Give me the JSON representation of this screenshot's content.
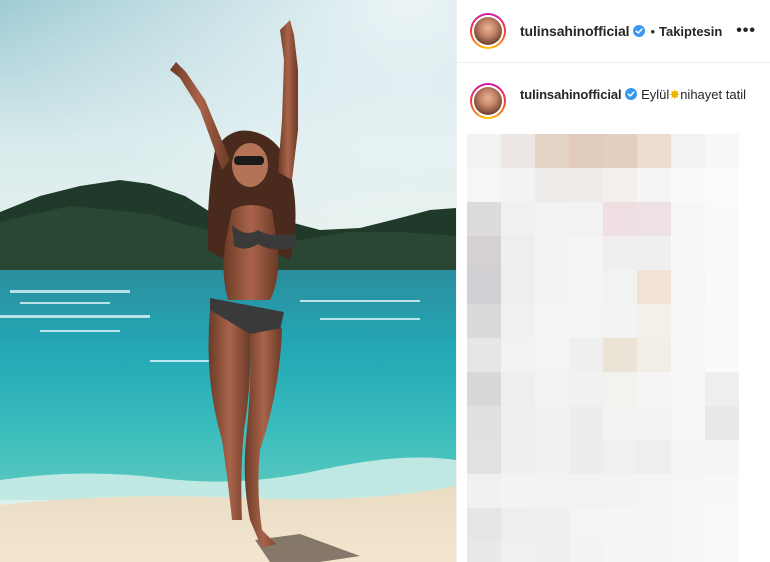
{
  "post": {
    "username": "tulinsahinofficial",
    "follow_status": "Takiptesin",
    "separator": "•",
    "more_label": "•••",
    "caption": {
      "username": "tulinsahinofficial",
      "text_before": "Eylül",
      "emoji": "✸",
      "text_after": "nihayet tatil"
    }
  },
  "colors": {
    "verified_blue": "#3897f0",
    "sea": "#22a7b4",
    "sky": "#cfe6ea"
  },
  "pixel_colors": [
    [
      "#f3f3f3",
      "#ece7e4",
      "#e4d4c6",
      "#e0cbbc",
      "#e3cfc0",
      "#ecdccf",
      "#f4f2f1",
      "#f7f7f7"
    ],
    [
      "#f6f6f6",
      "#f4f3f3",
      "#efebe9",
      "#eeebe9",
      "#f2efec",
      "#f6f5f4",
      "#fafafa",
      "#fbfbfb"
    ],
    [
      "#dedbdb",
      "#f1f0f0",
      "#f4f3f3",
      "#f3f2f2",
      "#efdfe3",
      "#eee1e6",
      "#f7f7f7",
      "#fafafa"
    ],
    [
      "#d5d1d1",
      "#eeeeee",
      "#f3f3f3",
      "#f5f5f5",
      "#f1eef0",
      "#f0eff0",
      "#f8f8f8",
      "#fafafa"
    ],
    [
      "#cfd0d3",
      "#efeff0",
      "#f3f3f3",
      "#f4f4f4",
      "#f2f2f2",
      "#f0e3d6",
      "#f6f6f6",
      "#fafafa"
    ],
    [
      "#dadadc",
      "#f0f0f0",
      "#f5f5f5",
      "#f4f4f4",
      "#f3f3f3",
      "#f5efe9",
      "#f7f7f7",
      "#fafafa"
    ],
    [
      "#e6e6e6",
      "#f2f2f2",
      "#f4f4f4",
      "#efefef",
      "#ebe3d6",
      "#f2ede7",
      "#f7f7f7",
      "#fafafa"
    ],
    [
      "#d9d8d8",
      "#efefef",
      "#f3f3f3",
      "#f1f1f1",
      "#f4f2ef",
      "#f6f5f3",
      "#f8f8f8",
      "#eeeeee"
    ],
    [
      "#e0e0e0",
      "#eeeeee",
      "#f1f1f1",
      "#ededed",
      "#f2f2f2",
      "#f3f3f3",
      "#f6f6f6",
      "#e9e9e9"
    ],
    [
      "#e2e0e0",
      "#efefef",
      "#f1f1f1",
      "#ededed",
      "#f0f0f0",
      "#eeeeee",
      "#f5f5f5",
      "#f4f4f4"
    ],
    [
      "#f1f1f1",
      "#f3f3f3",
      "#f2f2f2",
      "#f2f2f2",
      "#f3f3f3",
      "#f4f4f4",
      "#f6f6f6",
      "#f8f8f8"
    ],
    [
      "#e6e6e6",
      "#eeeeee",
      "#efefef",
      "#f4f4f4",
      "#f5f5f5",
      "#f4f4f4",
      "#f7f7f7",
      "#f9f9f9"
    ],
    [
      "#e9e9e9",
      "#f0f0f0",
      "#efefef",
      "#f3f3f3",
      "#f5f5f5",
      "#f5f5f5",
      "#f7f7f7",
      "#f9f9f9"
    ]
  ]
}
